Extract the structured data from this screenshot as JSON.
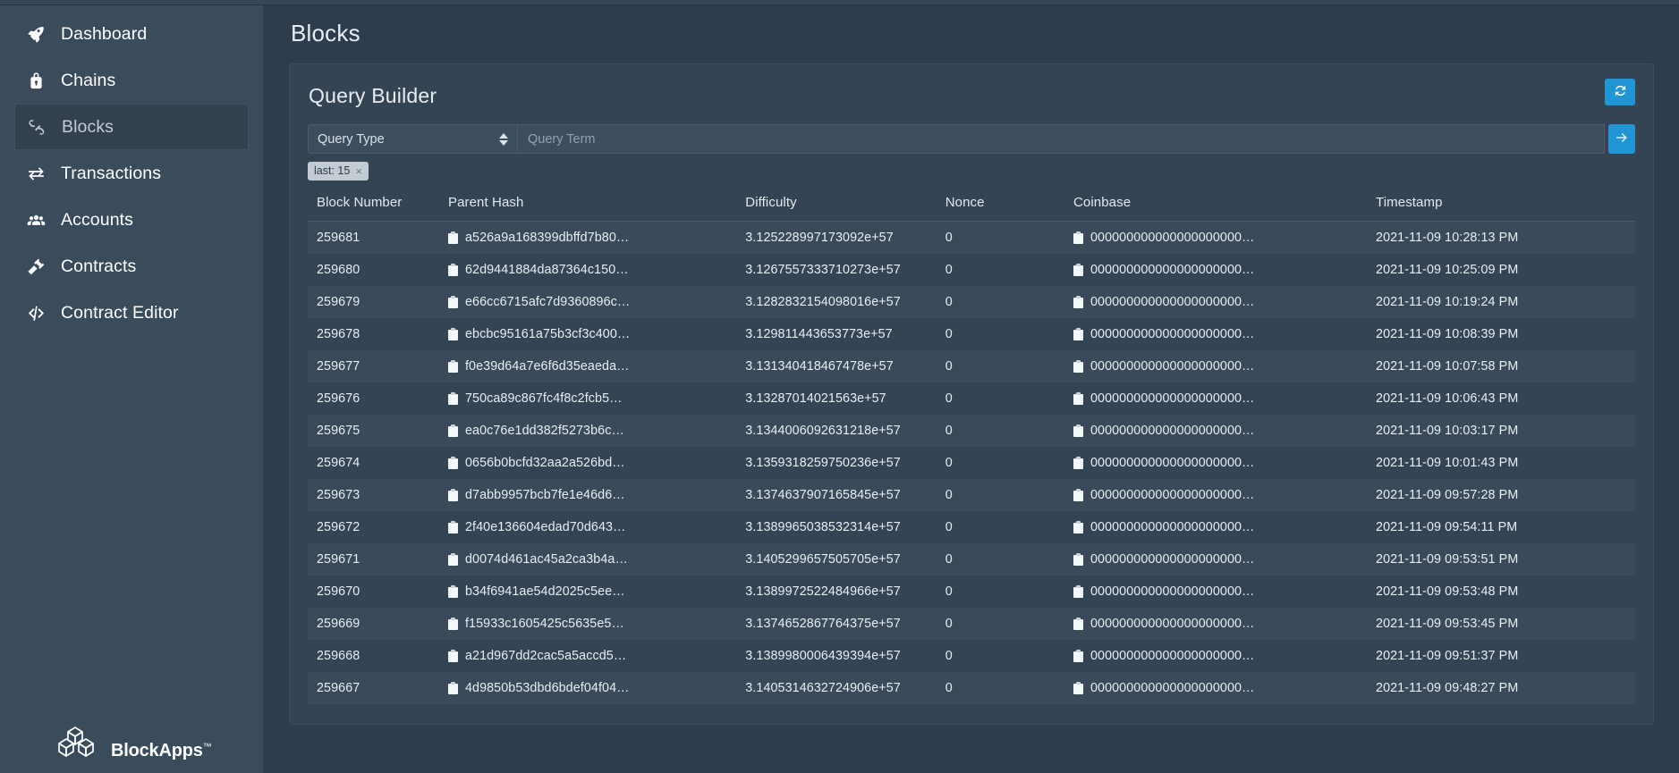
{
  "sidebar": {
    "items": [
      {
        "label": "Dashboard",
        "icon": "rocket-icon",
        "active": false
      },
      {
        "label": "Chains",
        "icon": "chain-lock-icon",
        "active": false
      },
      {
        "label": "Blocks",
        "icon": "link-chain-icon",
        "active": true
      },
      {
        "label": "Transactions",
        "icon": "exchange-arrows-icon",
        "active": false
      },
      {
        "label": "Accounts",
        "icon": "users-icon",
        "active": false
      },
      {
        "label": "Contracts",
        "icon": "gavel-icon",
        "active": false
      },
      {
        "label": "Contract Editor",
        "icon": "code-brackets-icon",
        "active": false
      }
    ],
    "brand": {
      "name": "BlockApps",
      "trademark": "™",
      "logo_icon": "blockapps-cube-logo"
    }
  },
  "header": {
    "page_title": "Blocks"
  },
  "panel": {
    "title": "Query Builder",
    "refresh_icon": "refresh-icon",
    "refresh_label": "Refresh"
  },
  "query": {
    "type_label": "Query Type",
    "type_options": [
      "Query Type"
    ],
    "term_value": "",
    "term_placeholder": "Query Term",
    "submit_icon": "arrow-right-icon",
    "chips": [
      {
        "label": "last: 15",
        "remove": "×"
      }
    ]
  },
  "table": {
    "columns": [
      "Block Number",
      "Parent Hash",
      "Difficulty",
      "Nonce",
      "Coinbase",
      "Timestamp"
    ],
    "copy_icon": "clipboard-copy-icon",
    "rows": [
      {
        "block_number": "259681",
        "parent_hash": "a526a9a168399dbffd7b80…",
        "difficulty": "3.125228997173092e+57",
        "nonce": "0",
        "coinbase": "000000000000000000000…",
        "timestamp": "2021-11-09 10:28:13 PM"
      },
      {
        "block_number": "259680",
        "parent_hash": "62d9441884da87364c150…",
        "difficulty": "3.1267557333710273e+57",
        "nonce": "0",
        "coinbase": "000000000000000000000…",
        "timestamp": "2021-11-09 10:25:09 PM"
      },
      {
        "block_number": "259679",
        "parent_hash": "e66cc6715afc7d9360896c…",
        "difficulty": "3.1282832154098016e+57",
        "nonce": "0",
        "coinbase": "000000000000000000000…",
        "timestamp": "2021-11-09 10:19:24 PM"
      },
      {
        "block_number": "259678",
        "parent_hash": "ebcbc95161a75b3cf3c400…",
        "difficulty": "3.129811443653773e+57",
        "nonce": "0",
        "coinbase": "000000000000000000000…",
        "timestamp": "2021-11-09 10:08:39 PM"
      },
      {
        "block_number": "259677",
        "parent_hash": "f0e39d64a7e6f6d35eaeda…",
        "difficulty": "3.131340418467478e+57",
        "nonce": "0",
        "coinbase": "000000000000000000000…",
        "timestamp": "2021-11-09 10:07:58 PM"
      },
      {
        "block_number": "259676",
        "parent_hash": "750ca89c867fc4f8c2fcb5…",
        "difficulty": "3.13287014021563e+57",
        "nonce": "0",
        "coinbase": "000000000000000000000…",
        "timestamp": "2021-11-09 10:06:43 PM"
      },
      {
        "block_number": "259675",
        "parent_hash": "ea0c76e1dd382f5273b6c…",
        "difficulty": "3.1344006092631218e+57",
        "nonce": "0",
        "coinbase": "000000000000000000000…",
        "timestamp": "2021-11-09 10:03:17 PM"
      },
      {
        "block_number": "259674",
        "parent_hash": "0656b0bcfd32aa2a526bd…",
        "difficulty": "3.1359318259750236e+57",
        "nonce": "0",
        "coinbase": "000000000000000000000…",
        "timestamp": "2021-11-09 10:01:43 PM"
      },
      {
        "block_number": "259673",
        "parent_hash": "d7abb9957bcb7fe1e46d6…",
        "difficulty": "3.1374637907165845e+57",
        "nonce": "0",
        "coinbase": "000000000000000000000…",
        "timestamp": "2021-11-09 09:57:28 PM"
      },
      {
        "block_number": "259672",
        "parent_hash": "2f40e136604edad70d643…",
        "difficulty": "3.1389965038532314e+57",
        "nonce": "0",
        "coinbase": "000000000000000000000…",
        "timestamp": "2021-11-09 09:54:11 PM"
      },
      {
        "block_number": "259671",
        "parent_hash": "d0074d461ac45a2ca3b4a…",
        "difficulty": "3.1405299657505705e+57",
        "nonce": "0",
        "coinbase": "000000000000000000000…",
        "timestamp": "2021-11-09 09:53:51 PM"
      },
      {
        "block_number": "259670",
        "parent_hash": "b34f6941ae54d2025c5ee…",
        "difficulty": "3.1389972522484966e+57",
        "nonce": "0",
        "coinbase": "000000000000000000000…",
        "timestamp": "2021-11-09 09:53:48 PM"
      },
      {
        "block_number": "259669",
        "parent_hash": "f15933c1605425c5635e5…",
        "difficulty": "3.1374652867764375e+57",
        "nonce": "0",
        "coinbase": "000000000000000000000…",
        "timestamp": "2021-11-09 09:53:45 PM"
      },
      {
        "block_number": "259668",
        "parent_hash": "a21d967dd2cac5a5accd5…",
        "difficulty": "3.1389980006439394e+57",
        "nonce": "0",
        "coinbase": "000000000000000000000…",
        "timestamp": "2021-11-09 09:51:37 PM"
      },
      {
        "block_number": "259667",
        "parent_hash": "4d9850b53dbd6bdef04f04…",
        "difficulty": "3.1405314632724906e+57",
        "nonce": "0",
        "coinbase": "000000000000000000000…",
        "timestamp": "2021-11-09 09:48:27 PM"
      }
    ]
  },
  "colors": {
    "sidebar_bg": "#3a4b5c",
    "main_bg": "#2e3d4d",
    "panel_bg": "#344454",
    "row_odd": "#3a4a5a",
    "accent": "#2196d4",
    "text": "#e9eef3",
    "chip_bg": "#c3cbd3"
  }
}
